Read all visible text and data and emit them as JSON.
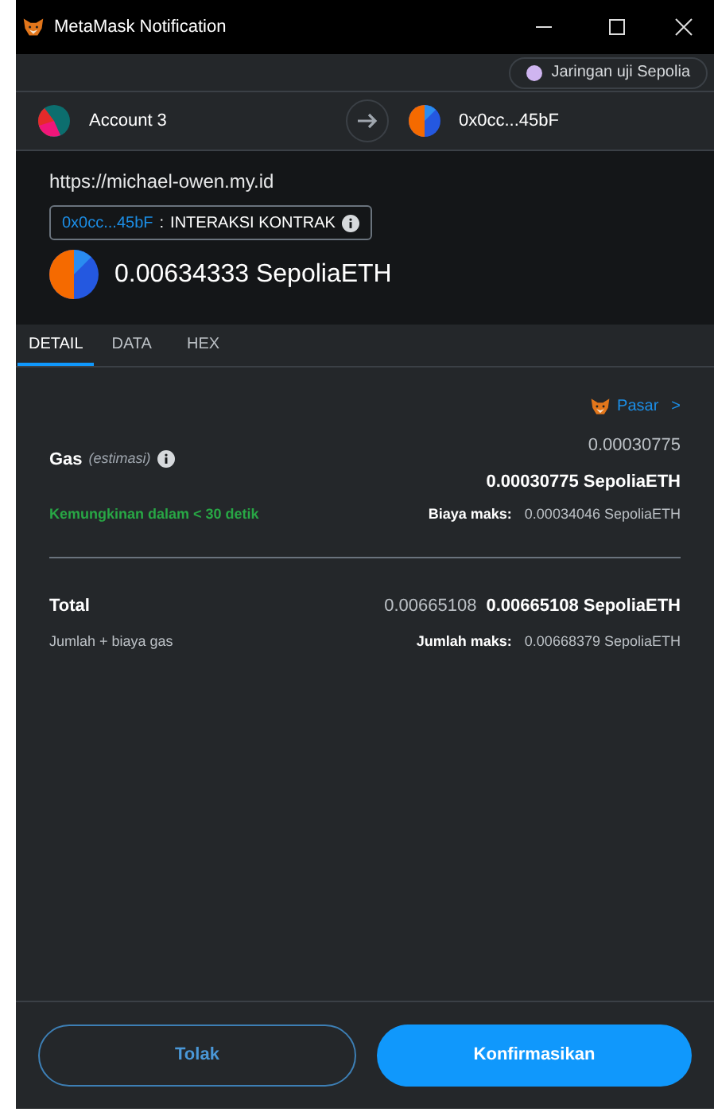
{
  "window": {
    "title": "MetaMask Notification"
  },
  "network": {
    "label": "Jaringan uji Sepolia",
    "color": "#cfb5f0"
  },
  "from_account": {
    "name": "Account 3"
  },
  "to_account": {
    "address": "0x0cc...45bF"
  },
  "origin": "https://michael-owen.my.id",
  "contract": {
    "address": "0x0cc...45bF",
    "separator": ":",
    "label": "INTERAKSI KONTRAK"
  },
  "amount": "0.00634333 SepoliaETH",
  "tabs": [
    {
      "label": "DETAIL",
      "selected": true
    },
    {
      "label": "DATA",
      "selected": false
    },
    {
      "label": "HEX",
      "selected": false
    }
  ],
  "market_link": {
    "label": "Pasar",
    "arrow": ">"
  },
  "gas": {
    "label": "Gas",
    "note": "(estimasi)",
    "value": "0.00030775",
    "value_eth": "0.00030775 SepoliaETH",
    "timing": "Kemungkinan dalam < 30 detik",
    "max_label": "Biaya maks:",
    "max_value": "0.00034046 SepoliaETH"
  },
  "total": {
    "label": "Total",
    "value": "0.00665108",
    "value_eth": "0.00665108 SepoliaETH",
    "sub": "Jumlah + biaya gas",
    "max_label": "Jumlah maks:",
    "max_value": "0.00668379 SepoliaETH"
  },
  "buttons": {
    "reject": "Tolak",
    "confirm": "Konfirmasikan"
  }
}
